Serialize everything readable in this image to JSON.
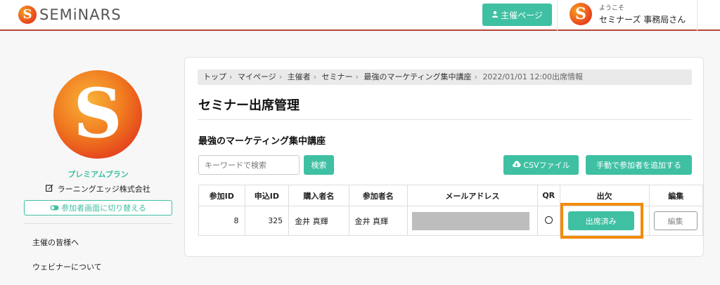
{
  "header": {
    "logo_mark": "S",
    "logo_text": "SEMiNARS",
    "organizer_button": "主催ページ",
    "user_avatar_letter": "S",
    "welcome": "ようこそ",
    "user_name": "セミナーズ 事務局さん"
  },
  "sidebar": {
    "avatar_letter": "S",
    "plan": "プレミアムプラン",
    "company": "ラーニングエッジ株式会社",
    "switch_button": "参加者画面に切り替える",
    "links": [
      "主催の皆様へ",
      "ウェビナーについて"
    ]
  },
  "breadcrumb": [
    "トップ",
    "マイページ",
    "主催者",
    "セミナー",
    "最強のマーケティング集中講座",
    "2022/01/01 12:00出席情報"
  ],
  "page_title": "セミナー出席管理",
  "seminar_name": "最強のマーケティング集中講座",
  "search": {
    "placeholder": "キーワードで検索",
    "button": "検索"
  },
  "csv_button": "CSVファイル",
  "add_button": "手動で参加者を追加する",
  "table": {
    "headers": [
      "参加ID",
      "申込ID",
      "購入者名",
      "参加者名",
      "メールアドレス",
      "QR",
      "出欠",
      "編集"
    ],
    "rows": [
      {
        "participant_id": "8",
        "application_id": "325",
        "buyer": "金井 真輝",
        "participant": "金井 真輝",
        "email": "",
        "qr": "○",
        "attendance": "出席済み",
        "edit": "編集"
      }
    ]
  },
  "colors": {
    "accent": "#3fc0a3",
    "header_rule": "#b5453c",
    "highlight": "#f28b0c"
  },
  "icons": [
    "user-icon",
    "edit-icon",
    "toggle-icon",
    "cloud-download-icon"
  ]
}
